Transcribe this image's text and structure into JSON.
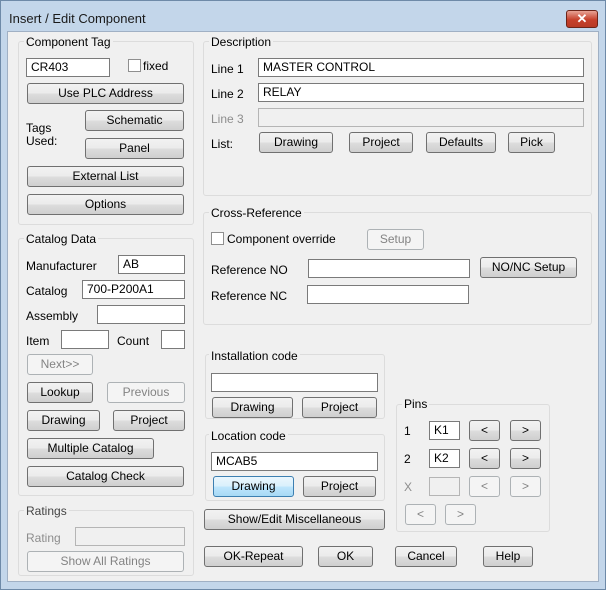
{
  "window": {
    "title": "Insert / Edit Component",
    "close_glyph": "✕"
  },
  "component_tag": {
    "group_label": "Component Tag",
    "tag_value": "CR403",
    "fixed_label": "fixed",
    "use_plc_label": "Use PLC Address",
    "tags_used_label": "Tags\nUsed:",
    "schematic_label": "Schematic",
    "panel_label": "Panel",
    "external_list_label": "External List",
    "options_label": "Options"
  },
  "catalog": {
    "group_label": "Catalog Data",
    "manufacturer_label": "Manufacturer",
    "manufacturer_value": "AB",
    "catalog_label": "Catalog",
    "catalog_value": "700-P200A1",
    "assembly_label": "Assembly",
    "assembly_value": "",
    "item_label": "Item",
    "item_value": "",
    "count_label": "Count",
    "count_value": "",
    "next_label": "Next>>",
    "lookup_label": "Lookup",
    "previous_label": "Previous",
    "drawing_label": "Drawing",
    "project_label": "Project",
    "multiple_catalog_label": "Multiple Catalog",
    "catalog_check_label": "Catalog Check"
  },
  "ratings": {
    "group_label": "Ratings",
    "rating_label": "Rating",
    "rating_value": "",
    "show_all_label": "Show All Ratings"
  },
  "description": {
    "group_label": "Description",
    "line1_label": "Line 1",
    "line1_value": "MASTER CONTROL",
    "line2_label": "Line 2",
    "line2_value": "RELAY",
    "line3_label": "Line 3",
    "line3_value": "",
    "list_label": "List:",
    "drawing_label": "Drawing",
    "project_label": "Project",
    "defaults_label": "Defaults",
    "pick_label": "Pick"
  },
  "cross_reference": {
    "group_label": "Cross-Reference",
    "override_label": "Component override",
    "setup_label": "Setup",
    "ref_no_label": "Reference NO",
    "ref_no_value": "",
    "no_nc_setup_label": "NO/NC Setup",
    "ref_nc_label": "Reference NC",
    "ref_nc_value": ""
  },
  "installation": {
    "group_label": "Installation code",
    "value": "",
    "drawing_label": "Drawing",
    "project_label": "Project"
  },
  "location": {
    "group_label": "Location code",
    "value": "MCAB5",
    "drawing_label": "Drawing",
    "project_label": "Project"
  },
  "pins": {
    "group_label": "Pins",
    "pin1_label": "1",
    "pin1_value": "K1",
    "pin2_label": "2",
    "pin2_value": "K2",
    "pin3_label": "X",
    "pin3_value": "",
    "prev_glyph": "<",
    "next_glyph": ">"
  },
  "misc_label": "Show/Edit Miscellaneous",
  "footer": {
    "ok_repeat_label": "OK-Repeat",
    "ok_label": "OK",
    "cancel_label": "Cancel",
    "help_label": "Help"
  }
}
